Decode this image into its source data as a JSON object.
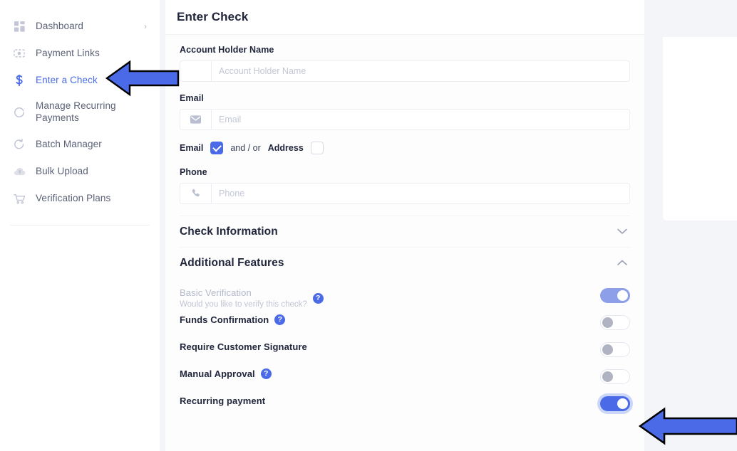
{
  "sidebar": {
    "items": [
      {
        "label": "Dashboard",
        "icon": "grid-icon",
        "active": false,
        "chevron": "›"
      },
      {
        "label": "Payment Links",
        "icon": "banknote-icon",
        "active": false
      },
      {
        "label": "Enter a Check",
        "icon": "dollar-sign-icon",
        "active": true
      },
      {
        "label": "Manage Recurring Payments",
        "icon": "circular-arrow-icon",
        "active": false
      },
      {
        "label": "Batch Manager",
        "icon": "refresh-icon",
        "active": false
      },
      {
        "label": "Bulk Upload",
        "icon": "cloud-upload-icon",
        "active": false
      },
      {
        "label": "Verification Plans",
        "icon": "shopping-cart-icon",
        "active": false
      }
    ]
  },
  "header": {
    "title": "Enter Check"
  },
  "form": {
    "account_holder": {
      "label": "Account Holder Name",
      "placeholder": "Account Holder Name",
      "value": ""
    },
    "email": {
      "label": "Email",
      "placeholder": "Email",
      "value": "",
      "icon": "envelope-icon"
    },
    "contact_choice": {
      "email_label": "Email",
      "conjunction": "and / or",
      "address_label": "Address",
      "email_checked": true,
      "address_checked": false
    },
    "phone": {
      "label": "Phone",
      "placeholder": "Phone",
      "value": "",
      "icon": "phone-icon"
    }
  },
  "sections": [
    {
      "title": "Check Information",
      "expanded": false,
      "chevron": "chevron-down-icon"
    },
    {
      "title": "Additional Features",
      "expanded": true,
      "chevron": "chevron-up-icon"
    }
  ],
  "features": [
    {
      "label": "Basic Verification",
      "sublabel": "Would you like to verify this check?",
      "help": true,
      "toggle_on": true,
      "disabled": true,
      "focused": false
    },
    {
      "label": "Funds Confirmation",
      "sublabel": "",
      "help": true,
      "toggle_on": false,
      "disabled": false,
      "focused": false
    },
    {
      "label": "Require Customer Signature",
      "sublabel": "",
      "help": false,
      "toggle_on": false,
      "disabled": false,
      "focused": false
    },
    {
      "label": "Manual Approval",
      "sublabel": "",
      "help": true,
      "toggle_on": false,
      "disabled": false,
      "focused": false
    },
    {
      "label": "Recurring payment",
      "sublabel": "",
      "help": false,
      "toggle_on": true,
      "disabled": false,
      "focused": true
    }
  ],
  "help_glyph": "?",
  "annotations": {
    "arrows": [
      {
        "name": "arrow-pointing-to-enter-a-check",
        "direction": "left"
      },
      {
        "name": "arrow-pointing-to-recurring-payment-toggle",
        "direction": "left"
      }
    ],
    "arrow_color": "#4a6ae8",
    "arrow_outline": "#000000"
  },
  "colors": {
    "accent": "#4a6ae8",
    "accent_muted": "#8c9fe8",
    "text_dark": "#21263c",
    "text_muted": "#5a6076",
    "page_bg": "#f4f5f8"
  }
}
